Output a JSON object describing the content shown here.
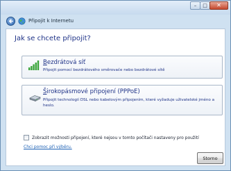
{
  "window": {
    "title": "Připojit k Internetu",
    "caption": {
      "minimize": "–",
      "maximize": "□",
      "close": "✕"
    }
  },
  "main": {
    "heading": "Jak se chcete připojit?",
    "options": [
      {
        "icon": "wireless-signal-icon",
        "title_mnemonic": "B",
        "title_rest": "ezdrátová síť",
        "description": "Připojit pomocí bezdrátového směrovače nebo bezdrátové sítě"
      },
      {
        "icon": "broadband-modem-icon",
        "title_mnemonic": "Š",
        "title_rest": "irokopásmové připojení (PPPoE)",
        "description": "Připojit technologií DSL nebo kabelovým připojením, které vyžaduje uživatelské jméno a heslo."
      }
    ],
    "show_options_label": "Zobrazit možnosti připojení, které nejsou v tomto počítači nastaveny pro použití",
    "show_options_checked": false,
    "help_link": "Chci pomoc při výběru."
  },
  "footer": {
    "cancel_label": "Storno"
  },
  "colors": {
    "heading": "#1e3287",
    "link": "#1a5fb4",
    "frame": "#cfe1f1"
  }
}
